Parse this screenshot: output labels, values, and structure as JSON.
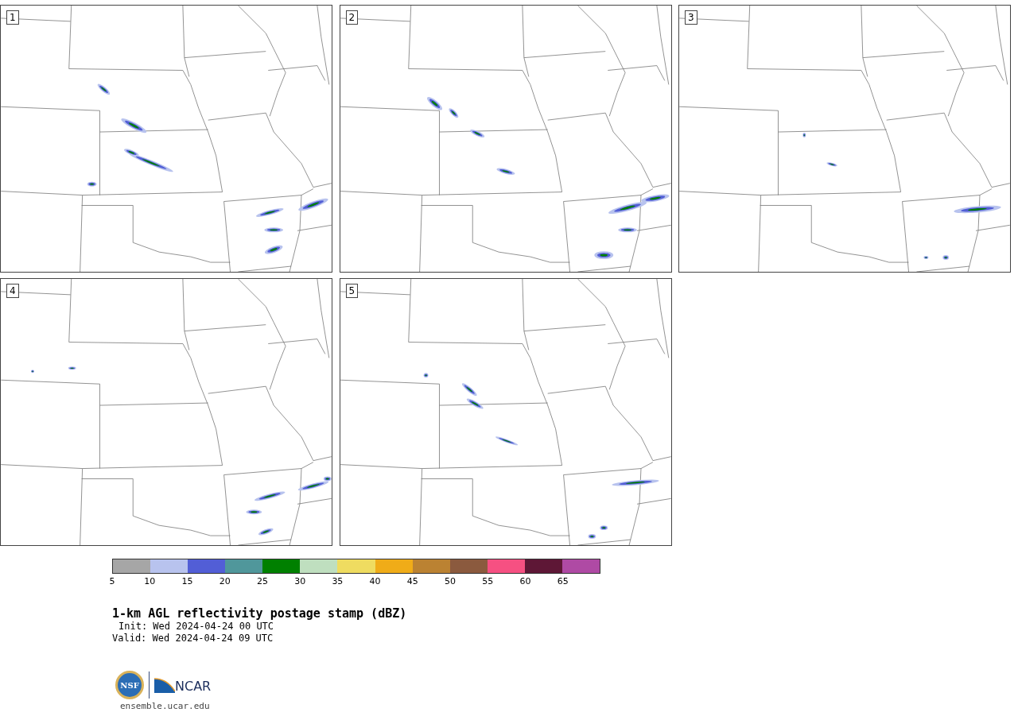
{
  "panels": [
    {
      "label": "1"
    },
    {
      "label": "2"
    },
    {
      "label": "3"
    },
    {
      "label": "4"
    },
    {
      "label": "5"
    }
  ],
  "colorbar": {
    "segments": [
      {
        "color": "#a6a6a6"
      },
      {
        "color": "#b8c3ee"
      },
      {
        "color": "#525ed6"
      },
      {
        "color": "#50979b"
      },
      {
        "color": "#008000"
      },
      {
        "color": "#bfdfbf"
      },
      {
        "color": "#efdc60"
      },
      {
        "color": "#f0ac18"
      },
      {
        "color": "#bb8232"
      },
      {
        "color": "#8b5a3e"
      },
      {
        "color": "#f65082"
      },
      {
        "color": "#5e1736"
      },
      {
        "color": "#af4aa4"
      }
    ],
    "ticks": [
      "5",
      "10",
      "15",
      "20",
      "25",
      "30",
      "35",
      "40",
      "45",
      "50",
      "55",
      "60",
      "65"
    ]
  },
  "title": "1-km AGL reflectivity postage stamp (dBZ)",
  "init": "Init: Wed 2024-04-24 00 UTC",
  "valid": "Valid: Wed 2024-04-24 09 UTC",
  "logos": {
    "nsf": "NSF",
    "ncar": "NCAR"
  },
  "website": "ensemble.ucar.edu"
}
